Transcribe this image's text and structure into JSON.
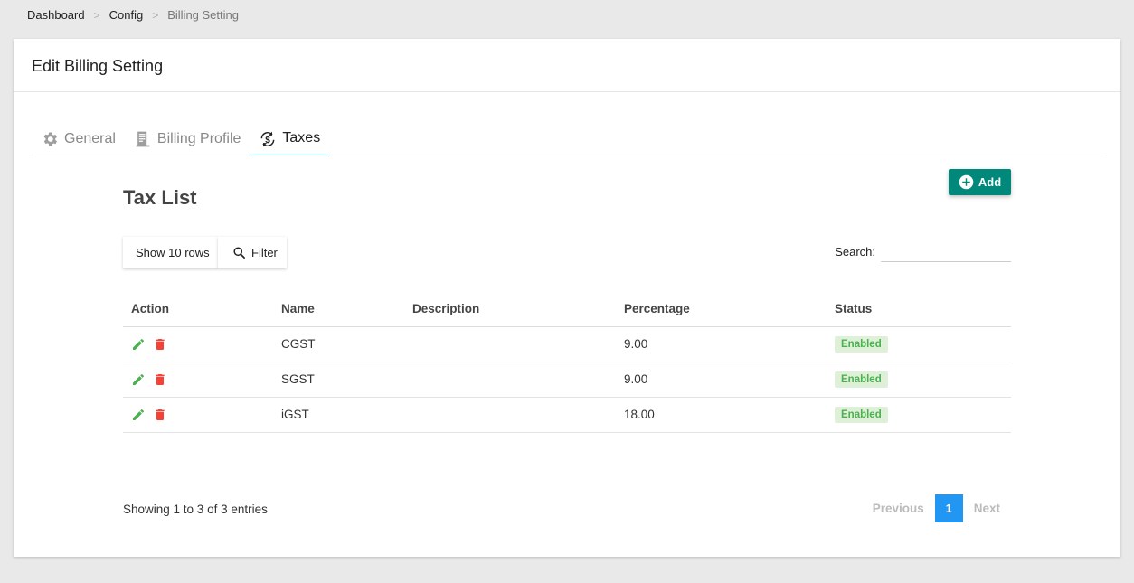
{
  "breadcrumb": {
    "items": [
      "Dashboard",
      "Config",
      "Billing Setting"
    ],
    "separator": ">"
  },
  "card": {
    "title": "Edit Billing Setting"
  },
  "tabs": [
    {
      "label": "General",
      "icon": "gear-icon",
      "active": false
    },
    {
      "label": "Billing Profile",
      "icon": "receipt-icon",
      "active": false
    },
    {
      "label": "Taxes",
      "icon": "dollar-sync-icon",
      "active": true
    }
  ],
  "add_button": {
    "label": "Add",
    "icon": "plus-circle-icon",
    "color": "#00897b"
  },
  "tax_list": {
    "title": "Tax List",
    "rows_button": "Show 10 rows",
    "filter_button": "Filter",
    "search_label": "Search:",
    "search_value": "",
    "columns": [
      "Action",
      "Name",
      "Description",
      "Percentage",
      "Status"
    ],
    "rows": [
      {
        "name": "CGST",
        "description": "",
        "percentage": "9.00",
        "status": "Enabled"
      },
      {
        "name": "SGST",
        "description": "",
        "percentage": "9.00",
        "status": "Enabled"
      },
      {
        "name": "iGST",
        "description": "",
        "percentage": "18.00",
        "status": "Enabled"
      }
    ],
    "info": "Showing 1 to 3 of 3 entries",
    "pagination": {
      "previous": "Previous",
      "current": "1",
      "next": "Next"
    }
  },
  "colors": {
    "accent": "#2196f3",
    "edit": "#4caf50",
    "delete": "#f44336",
    "status_bg": "#dff0d8"
  }
}
